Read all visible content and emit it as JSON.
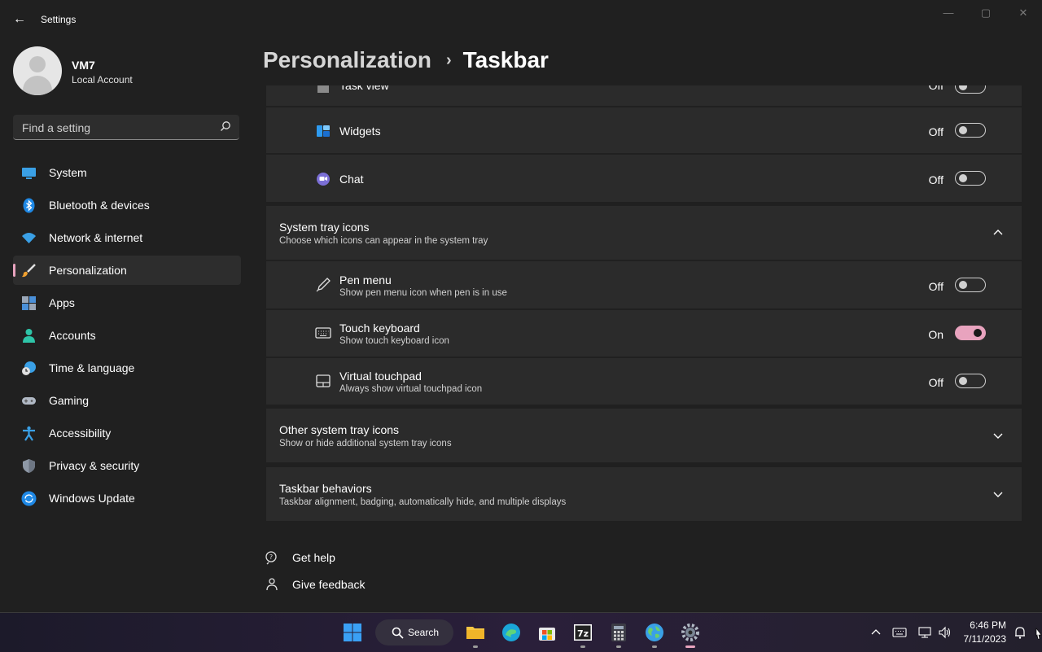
{
  "window": {
    "title": "Settings",
    "minimize": "—",
    "restore": "▢",
    "close": "✕",
    "back": "←"
  },
  "profile": {
    "name": "VM7",
    "account_type": "Local Account"
  },
  "search": {
    "placeholder": "Find a setting"
  },
  "sidebar": {
    "items": [
      {
        "label": "System",
        "icon": "monitor-icon"
      },
      {
        "label": "Bluetooth & devices",
        "icon": "bluetooth-icon"
      },
      {
        "label": "Network & internet",
        "icon": "wifi-icon"
      },
      {
        "label": "Personalization",
        "icon": "brush-icon",
        "active": true
      },
      {
        "label": "Apps",
        "icon": "apps-icon"
      },
      {
        "label": "Accounts",
        "icon": "person-icon"
      },
      {
        "label": "Time & language",
        "icon": "clock-globe-icon"
      },
      {
        "label": "Gaming",
        "icon": "gamepad-icon"
      },
      {
        "label": "Accessibility",
        "icon": "accessibility-icon"
      },
      {
        "label": "Privacy & security",
        "icon": "shield-icon"
      },
      {
        "label": "Windows Update",
        "icon": "update-icon"
      }
    ]
  },
  "header": {
    "breadcrumb": "Personalization",
    "separator": "›",
    "title": "Taskbar"
  },
  "taskbar_items": {
    "partial_row": {
      "label": "Task view",
      "state": "Off"
    },
    "widgets": {
      "label": "Widgets",
      "state": "Off",
      "on": false
    },
    "chat": {
      "label": "Chat",
      "state": "Off",
      "on": false
    }
  },
  "system_tray": {
    "title": "System tray icons",
    "subtitle": "Choose which icons can appear in the system tray",
    "items": [
      {
        "label": "Pen menu",
        "sub": "Show pen menu icon when pen is in use",
        "state": "Off",
        "on": false,
        "icon": "pen-icon"
      },
      {
        "label": "Touch keyboard",
        "sub": "Show touch keyboard icon",
        "state": "On",
        "on": true,
        "icon": "keyboard-icon"
      },
      {
        "label": "Virtual touchpad",
        "sub": "Always show virtual touchpad icon",
        "state": "Off",
        "on": false,
        "icon": "touchpad-icon"
      }
    ]
  },
  "other_tray": {
    "title": "Other system tray icons",
    "subtitle": "Show or hide additional system tray icons"
  },
  "behaviors": {
    "title": "Taskbar behaviors",
    "subtitle": "Taskbar alignment, badging, automatically hide, and multiple displays"
  },
  "help": {
    "get_help": "Get help",
    "give_feedback": "Give feedback"
  },
  "taskbar": {
    "search_label": "Search",
    "time": "6:46 PM",
    "date": "7/11/2023"
  },
  "colors": {
    "accent": "#e8a3be",
    "background": "#202020",
    "card": "#2b2b2b"
  }
}
